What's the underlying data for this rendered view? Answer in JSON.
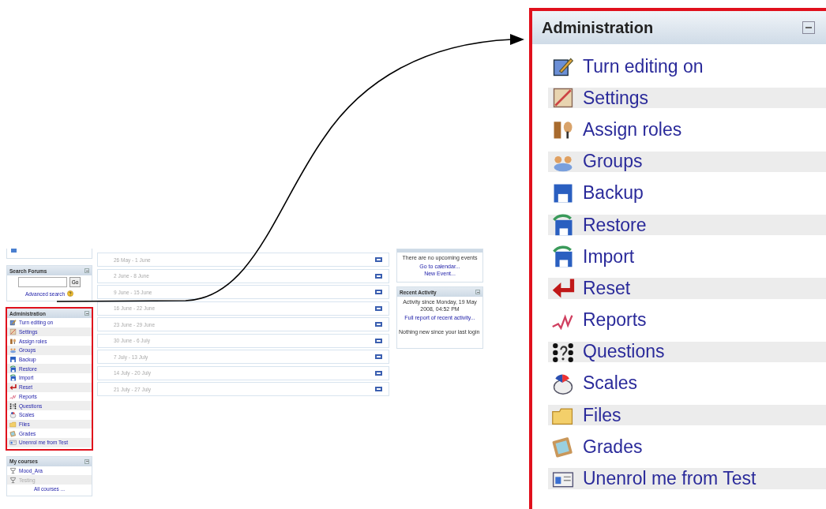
{
  "screenshot": {
    "search_forums": {
      "title": "Search Forums",
      "go_button": "Go",
      "advanced_link": "Advanced search"
    },
    "administration": {
      "title": "Administration",
      "items": [
        {
          "label": "Turn editing on",
          "kind": "edit"
        },
        {
          "label": "Settings",
          "kind": "settings"
        },
        {
          "label": "Assign roles",
          "kind": "roles"
        },
        {
          "label": "Groups",
          "kind": "groups"
        },
        {
          "label": "Backup",
          "kind": "backup"
        },
        {
          "label": "Restore",
          "kind": "restore"
        },
        {
          "label": "Import",
          "kind": "import"
        },
        {
          "label": "Reset",
          "kind": "reset"
        },
        {
          "label": "Reports",
          "kind": "reports"
        },
        {
          "label": "Questions",
          "kind": "questions"
        },
        {
          "label": "Scales",
          "kind": "scales"
        },
        {
          "label": "Files",
          "kind": "files"
        },
        {
          "label": "Grades",
          "kind": "grades"
        },
        {
          "label": "Unenrol me from Test",
          "kind": "unenrol"
        }
      ]
    },
    "my_courses": {
      "title": "My courses",
      "items": [
        {
          "label": "Mood_Ara",
          "dimmed": false
        },
        {
          "label": "Testing",
          "dimmed": true
        }
      ],
      "all_link": "All courses ..."
    },
    "weeks": [
      "26 May - 1 June",
      "2 June - 8 June",
      "9 June - 15 June",
      "16 June - 22 June",
      "23 June - 29 June",
      "30 June - 6 July",
      "7 July - 13 July",
      "14 July - 20 July",
      "21 July - 27 July"
    ],
    "upcoming_events": {
      "message": "There are no upcoming events",
      "links": [
        "Go to calendar...",
        "New Event..."
      ]
    },
    "recent_activity": {
      "title": "Recent Activity",
      "since": "Activity since Monday, 19 May 2008, 04:52 PM",
      "report_link": "Full report of recent activity...",
      "message": "Nothing new since your last login"
    }
  },
  "callout": {
    "title": "Administration",
    "items": [
      {
        "label": "Turn editing on",
        "kind": "edit"
      },
      {
        "label": "Settings",
        "kind": "settings"
      },
      {
        "label": "Assign roles",
        "kind": "roles"
      },
      {
        "label": "Groups",
        "kind": "groups"
      },
      {
        "label": "Backup",
        "kind": "backup"
      },
      {
        "label": "Restore",
        "kind": "restore"
      },
      {
        "label": "Import",
        "kind": "import"
      },
      {
        "label": "Reset",
        "kind": "reset"
      },
      {
        "label": "Reports",
        "kind": "reports"
      },
      {
        "label": "Questions",
        "kind": "questions"
      },
      {
        "label": "Scales",
        "kind": "scales"
      },
      {
        "label": "Files",
        "kind": "files"
      },
      {
        "label": "Grades",
        "kind": "grades"
      },
      {
        "label": "Unenrol me from Test",
        "kind": "unenrol"
      }
    ]
  }
}
